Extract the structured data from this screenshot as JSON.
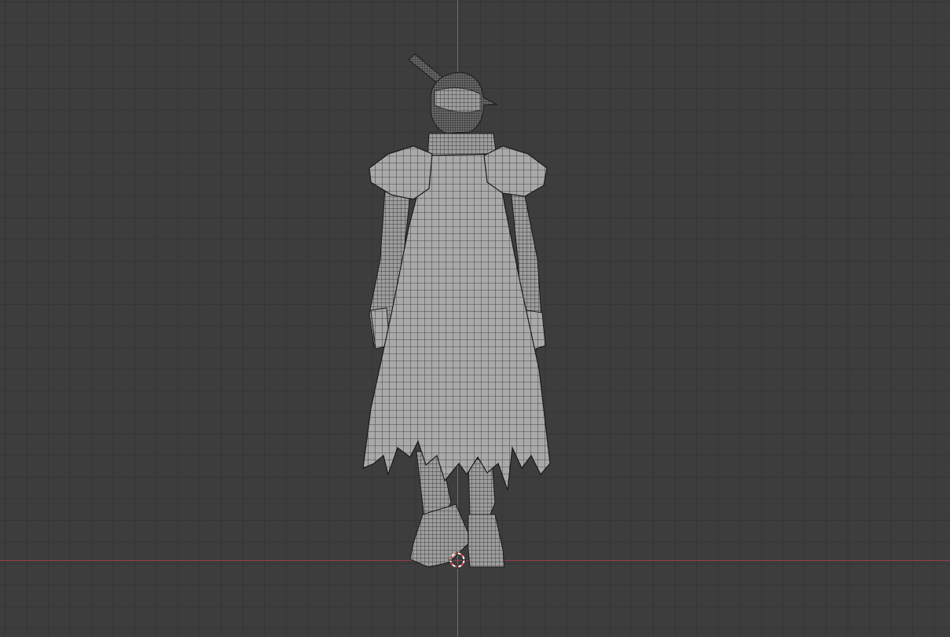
{
  "viewport": {
    "background": "#3d3d3d",
    "grid_color": "#353535",
    "x_axis_color": "#9b3b47",
    "y_axis_color": "#4a79b3"
  },
  "scene": {
    "object": "cloaked-character-mesh",
    "display": "wireframe-over-solid",
    "mesh_fill": "#a9a9a9",
    "wire_color": "#2a2a2a"
  },
  "cursor_3d": {
    "icon": "3d-cursor-icon",
    "ring_colors": [
      "#e04a4a",
      "#ffffff"
    ]
  }
}
